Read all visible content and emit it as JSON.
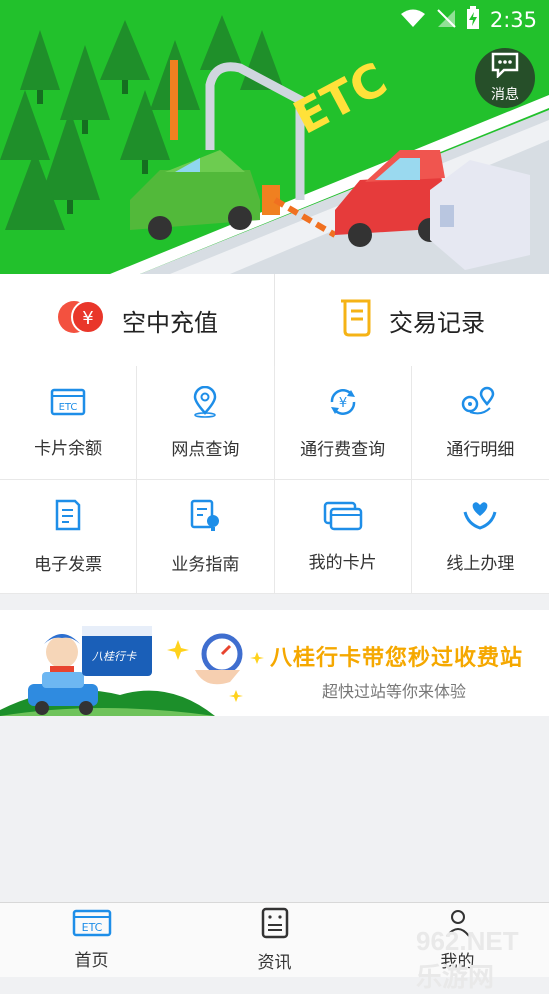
{
  "status_bar": {
    "time": "2:35"
  },
  "header": {
    "message_label": "消息",
    "banner_sign": "ETC"
  },
  "quick_actions": [
    {
      "label": "空中充值",
      "icon": "coin-icon"
    },
    {
      "label": "交易记录",
      "icon": "receipt-icon"
    }
  ],
  "grid_items": [
    {
      "label": "卡片余额",
      "icon": "etc-card-icon"
    },
    {
      "label": "网点查询",
      "icon": "location-pin-icon"
    },
    {
      "label": "通行费查询",
      "icon": "yuan-refresh-icon"
    },
    {
      "label": "通行明细",
      "icon": "route-icon"
    },
    {
      "label": "电子发票",
      "icon": "invoice-icon"
    },
    {
      "label": "业务指南",
      "icon": "guide-icon"
    },
    {
      "label": "我的卡片",
      "icon": "cards-icon"
    },
    {
      "label": "线上办理",
      "icon": "hands-heart-icon"
    }
  ],
  "promo": {
    "title": "八桂行卡带您秒过收费站",
    "subtitle": "超快过站等你来体验",
    "card_text": "八桂行卡"
  },
  "tabbar": [
    {
      "label": "首页",
      "icon": "etc-icon"
    },
    {
      "label": "资讯",
      "icon": "news-icon"
    },
    {
      "label": "我的",
      "icon": "profile-icon"
    }
  ],
  "watermark": "962.NET 乐游网",
  "colors": {
    "accent": "#1e8ee8",
    "banner_green": "#23c02e",
    "promo_gold": "#f5a800"
  }
}
